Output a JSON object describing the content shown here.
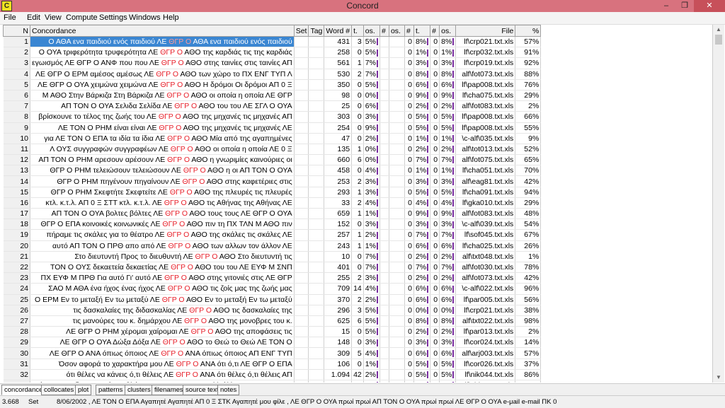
{
  "window": {
    "title": "Concord",
    "icon_letter": "C",
    "minimize": "–",
    "maximize": "❐",
    "close": "✕"
  },
  "menu": [
    "File",
    "Edit",
    "View",
    "Compute",
    "Settings",
    "Windows",
    "Help"
  ],
  "columns": {
    "n": "N",
    "concordance": "Concordance",
    "set": "Set",
    "tag": "Tag",
    "word": "Word #",
    "t1": "t.",
    "os1": "os.",
    "d1": "#",
    "os2": "os.",
    "d2": "#",
    "t2": "t.",
    "d3": "#",
    "os3": "os.",
    "file": "File",
    "pct": "%"
  },
  "rows": [
    {
      "n": "1",
      "left": "Ο ΑΘΑ ενα παιδιού ενός παιδιού ΛΕ",
      "kw": "ΘΓΡ Ο",
      "right": "ΑΘΑ ενα παιδιού ενός παιδιού",
      "word": "431",
      "sent": "3",
      "sp": "5%",
      "para": "0",
      "pp": "8%",
      "head": "0",
      "hp": "8%",
      "file": "lf\\crp021.txt.xls",
      "pct": "57%"
    },
    {
      "n": "2",
      "left": "Ο ΟΥΑ τριφερότητα τρυφερότητα ΛΕ",
      "kw": "ΘΓΡ Ο",
      "right": "ΑΘΟ της καρδιάς τις της καρδιάς",
      "word": "258",
      "sent": "0",
      "sp": "5%",
      "para": "0",
      "pp": "1%",
      "head": "0",
      "hp": "1%",
      "file": "lf\\crp032.txt.xls",
      "pct": "91%"
    },
    {
      "n": "3",
      "left": "εγωισμός ΛΕ ΘΓΡ Ο ΑΝΦ που που ΛΕ",
      "kw": "ΘΓΡ Ο",
      "right": "ΑΘΟ στης ταινίες στις ταινίες ΑΠ",
      "word": "561",
      "sent": "1",
      "sp": "7%",
      "para": "0",
      "pp": "3%",
      "head": "0",
      "hp": "3%",
      "file": "lf\\crp019.txt.xls",
      "pct": "92%"
    },
    {
      "n": "4",
      "left": "ΛΕ ΘΓΡ Ο ΕΡΜ αμέσος αμέσως ΛΕ",
      "kw": "ΘΓΡ Ο",
      "right": "ΑΘΟ των χώρο το ΠΧ ΕΝΓ ΤΥΠ Λ",
      "word": "530",
      "sent": "2",
      "sp": "7%",
      "para": "0",
      "pp": "8%",
      "head": "0",
      "hp": "8%",
      "file": "alf\\fot073.txt.xls",
      "pct": "88%"
    },
    {
      "n": "5",
      "left": "ΛΕ ΘΓΡ Ο ΟΥΑ χειμώνα χειμώνα ΛΕ",
      "kw": "ΘΓΡ Ο",
      "right": "ΑΘΟ Η δρόμοι Οι δρόμοι ΑΠ 0 Ξ",
      "word": "350",
      "sent": "0",
      "sp": "5%",
      "para": "0",
      "pp": "6%",
      "head": "0",
      "hp": "6%",
      "file": "lf\\pap008.txt.xls",
      "pct": "76%"
    },
    {
      "n": "6",
      "left": "Μ ΑΘΟ Στην Βάρκιζα Στη Βάρκιζα ΛΕ",
      "kw": "ΘΓΡ Ο",
      "right": "ΑΘΟ οι οποία η οποία ΛΕ ΘΓΡ",
      "word": "98",
      "sent": "0",
      "sp": "0%",
      "para": "0",
      "pp": "9%",
      "head": "0",
      "hp": "9%",
      "file": "lf\\cha075.txt.xls",
      "pct": "29%"
    },
    {
      "n": "7",
      "left": "ΑΠ ΤΟΝ Ο ΟΥΑ Σελιδα Σελίδα ΛΕ",
      "kw": "ΘΓΡ Ο",
      "right": "ΑΘΟ του του ΛΕ ΣΓΛ Ο ΟΥΑ",
      "word": "25",
      "sent": "0",
      "sp": "6%",
      "para": "0",
      "pp": "2%",
      "head": "0",
      "hp": "2%",
      "file": "alf\\fot083.txt.xls",
      "pct": "2%"
    },
    {
      "n": "8",
      "left": "βρίσκουνε το τέλος της ζωής του ΛΕ",
      "kw": "ΘΓΡ Ο",
      "right": "ΑΘΟ της μηχανές τις μηχανές ΑΠ",
      "word": "303",
      "sent": "0",
      "sp": "3%",
      "para": "0",
      "pp": "5%",
      "head": "0",
      "hp": "5%",
      "file": "lf\\pap008.txt.xls",
      "pct": "66%"
    },
    {
      "n": "9",
      "left": "ΛΕ ΤΟΝ Ο ΡΗΜ είναι είναι ΛΕ",
      "kw": "ΘΓΡ Ο",
      "right": "ΑΘΟ της μηχανές τις μηχανές ΛΕ",
      "word": "254",
      "sent": "0",
      "sp": "9%",
      "para": "0",
      "pp": "5%",
      "head": "0",
      "hp": "5%",
      "file": "lf\\pap008.txt.xls",
      "pct": "55%"
    },
    {
      "n": "10",
      "left": "για ΛΕ ΤΟΝ Ο ΕΠΑ τα ιδία τα ίδια ΛΕ",
      "kw": "ΘΓΡ Ο",
      "right": "ΑΘΟ Μία από της αγαπημένες",
      "word": "47",
      "sent": "0",
      "sp": "2%",
      "para": "0",
      "pp": "1%",
      "head": "0",
      "hp": "1%",
      "file": "\\c-alf\\035.txt.xls",
      "pct": "9%"
    },
    {
      "n": "11",
      "left": "Λ ΟΥΣ συγγραφών συγγραφέων ΛΕ",
      "kw": "ΘΓΡ Ο",
      "right": "ΑΘΟ οι οποία η οποία ΛΕ 0 Ξ",
      "word": "135",
      "sent": "1",
      "sp": "0%",
      "para": "0",
      "pp": "2%",
      "head": "0",
      "hp": "2%",
      "file": "alf\\tot013.txt.xls",
      "pct": "52%"
    },
    {
      "n": "12",
      "left": "ΑΠ ΤΟΝ Ο ΡΗΜ αρεσουν αρέσουν ΛΕ",
      "kw": "ΘΓΡ Ο",
      "right": "ΑΘΟ η γνωριμίες καινούριες οι",
      "word": "660",
      "sent": "6",
      "sp": "0%",
      "para": "0",
      "pp": "7%",
      "head": "0",
      "hp": "7%",
      "file": "alf\\fot075.txt.xls",
      "pct": "65%"
    },
    {
      "n": "13",
      "left": "ΘΓΡ Ο ΡΗΜ τελειώσουν τελειώσουν ΛΕ",
      "kw": "ΘΓΡ Ο",
      "right": "ΑΘΟ η οι ΑΠ ΤΟΝ Ο ΟΥΑ",
      "word": "458",
      "sent": "0",
      "sp": "4%",
      "para": "0",
      "pp": "1%",
      "head": "0",
      "hp": "1%",
      "file": "lf\\cha051.txt.xls",
      "pct": "70%"
    },
    {
      "n": "14",
      "left": "ΘΓΡ Ο ΡΗΜ πηγένουν πηγαίνουν ΛΕ",
      "kw": "ΘΓΡ Ο",
      "right": "ΑΘΟ στης καφετέριες στις",
      "word": "253",
      "sent": "2",
      "sp": "3%",
      "para": "0",
      "pp": "3%",
      "head": "0",
      "hp": "3%",
      "file": "alf\\eag81.txt.xls",
      "pct": "42%"
    },
    {
      "n": "15",
      "left": "ΘΓΡ Ο ΡΗΜ Σκεφτήτε Σκεφτείτε ΛΕ",
      "kw": "ΘΓΡ Ο",
      "right": "ΑΘΟ της πλευρές τις πλευρές",
      "word": "293",
      "sent": "1",
      "sp": "3%",
      "para": "0",
      "pp": "5%",
      "head": "0",
      "hp": "5%",
      "file": "lf\\cha091.txt.xls",
      "pct": "94%"
    },
    {
      "n": "16",
      "left": "κτλ. κ.τ.λ. ΑΠ 0 Ξ ΣΤΤ κτλ. κ.τ.λ. ΛΕ",
      "kw": "ΘΓΡ Ο",
      "right": "ΑΘΟ τις Αθήνας της Αθήνας ΛΕ",
      "word": "33",
      "sent": "2",
      "sp": "4%",
      "para": "0",
      "pp": "4%",
      "head": "0",
      "hp": "4%",
      "file": "lf\\gka010.txt.xls",
      "pct": "29%"
    },
    {
      "n": "17",
      "left": "ΑΠ ΤΟΝ Ο ΟΥΑ βολτες βόλτες ΛΕ",
      "kw": "ΘΓΡ Ο",
      "right": "ΑΘΟ τους τους ΛΕ ΘΓΡ Ο ΟΥΑ",
      "word": "659",
      "sent": "1",
      "sp": "1%",
      "para": "0",
      "pp": "9%",
      "head": "0",
      "hp": "9%",
      "file": "alf\\fot083.txt.xls",
      "pct": "48%"
    },
    {
      "n": "18",
      "left": "ΘΓΡ Ο ΕΠΑ κοινοικές κοινωνικές ΛΕ",
      "kw": "ΘΓΡ Ο",
      "right": "ΑΘΟ πιν τη ΠΧ ΤΛΝ Μ ΑΘΟ πιν",
      "word": "152",
      "sent": "0",
      "sp": "3%",
      "para": "0",
      "pp": "3%",
      "head": "0",
      "hp": "3%",
      "file": "\\c-alf\\039.txt.xls",
      "pct": "54%"
    },
    {
      "n": "19",
      "left": "πήραμε τις σκάλες για το θέατρο ΛΕ",
      "kw": "ΘΓΡ Ο",
      "right": "ΑΘΟ της σκάλες τις σκάλες ΛΕ",
      "word": "257",
      "sent": "1",
      "sp": "2%",
      "para": "0",
      "pp": "7%",
      "head": "0",
      "hp": "7%",
      "file": "lf\\sof045.txt.xls",
      "pct": "67%"
    },
    {
      "n": "20",
      "left": "αυτό ΑΠ ΤΟΝ Ο ΠΡΘ απο από ΛΕ",
      "kw": "ΘΓΡ Ο",
      "right": "ΑΘΟ των αλλων τον άλλον ΛΕ",
      "word": "243",
      "sent": "1",
      "sp": "1%",
      "para": "0",
      "pp": "6%",
      "head": "0",
      "hp": "6%",
      "file": "lf\\cha025.txt.xls",
      "pct": "26%"
    },
    {
      "n": "21",
      "left": "Στο διευτυντή Προς το διευθυντή ΛΕ",
      "kw": "ΘΓΡ Ο",
      "right": "ΑΘΟ Στο διευτυντή τις",
      "word": "10",
      "sent": "0",
      "sp": "7%",
      "para": "0",
      "pp": "2%",
      "head": "0",
      "hp": "2%",
      "file": "alf\\txt048.txt.xls",
      "pct": "1%"
    },
    {
      "n": "22",
      "left": "ΤΟΝ Ο ΟΥΣ δεκαετεία δεκαετίας ΛΕ",
      "kw": "ΘΓΡ Ο",
      "right": "ΑΘΟ του του ΛΕ ΕΥΦ Μ ΣΝΠ",
      "word": "401",
      "sent": "0",
      "sp": "7%",
      "para": "0",
      "pp": "7%",
      "head": "0",
      "hp": "7%",
      "file": "alf\\fot030.txt.xls",
      "pct": "78%"
    },
    {
      "n": "23",
      "left": "ΠΧ ΕΥΦ Μ ΠΡΘ Για αυτό Γι' αυτό ΛΕ",
      "kw": "ΘΓΡ Ο",
      "right": "ΑΘΟ στης γιτονιές στις ΛΕ ΘΓΡ",
      "word": "255",
      "sent": "2",
      "sp": "3%",
      "para": "0",
      "pp": "2%",
      "head": "0",
      "hp": "2%",
      "file": "alf\\fot073.txt.xls",
      "pct": "42%"
    },
    {
      "n": "24",
      "left": "ΣΑΟ Μ ΑΘΑ ένα ήχος ένας ήχος ΛΕ",
      "kw": "ΘΓΡ Ο",
      "right": "ΑΘΟ τις ζοίς μας της ζωής μας",
      "word": "709",
      "sent": "14",
      "sp": "4%",
      "para": "0",
      "pp": "6%",
      "head": "0",
      "hp": "6%",
      "file": "\\c-alf\\022.txt.xls",
      "pct": "96%"
    },
    {
      "n": "25",
      "left": "Ο ΕΡΜ Εν το μεταξή Εν τω μεταξύ ΛΕ",
      "kw": "ΘΓΡ Ο",
      "right": "ΑΘΟ Εν το μεταξή Εν τω μεταξύ",
      "word": "370",
      "sent": "2",
      "sp": "2%",
      "para": "0",
      "pp": "6%",
      "head": "0",
      "hp": "6%",
      "file": "lf\\par005.txt.xls",
      "pct": "56%"
    },
    {
      "n": "26",
      "left": "τις δασκαλαίες της διδασκαλίας ΛΕ",
      "kw": "ΘΓΡ Ο",
      "right": "ΑΘΟ τις δασκαλαίες της",
      "word": "296",
      "sent": "3",
      "sp": "5%",
      "para": "0",
      "pp": "0%",
      "head": "0",
      "hp": "0%",
      "file": "lf\\crp021.txt.xls",
      "pct": "38%"
    },
    {
      "n": "27",
      "left": "τις μανούρες του κ. δημάρχου ΛΕ",
      "kw": "ΘΓΡ Ο",
      "right": "ΑΘΟ της μονοβρες του κ.",
      "word": "625",
      "sent": "6",
      "sp": "5%",
      "para": "0",
      "pp": "8%",
      "head": "0",
      "hp": "8%",
      "file": "alf\\txt022.txt.xls",
      "pct": "98%"
    },
    {
      "n": "28",
      "left": "ΛΕ ΘΓΡ Ο ΡΗΜ χέρομαι χαίρομαι ΛΕ",
      "kw": "ΘΓΡ Ο",
      "right": "ΑΘΟ της αποφάσεις τις",
      "word": "15",
      "sent": "0",
      "sp": "5%",
      "para": "0",
      "pp": "2%",
      "head": "0",
      "hp": "2%",
      "file": "lf\\par013.txt.xls",
      "pct": "2%"
    },
    {
      "n": "29",
      "left": "ΛΕ ΘΓΡ Ο ΟΥΑ Δώξα Δόξα ΛΕ",
      "kw": "ΘΓΡ Ο",
      "right": "ΑΘΟ το Θεώ το Θεώ ΛΕ ΤΟΝ Ο",
      "word": "148",
      "sent": "0",
      "sp": "3%",
      "para": "0",
      "pp": "3%",
      "head": "0",
      "hp": "3%",
      "file": "lf\\cor024.txt.xls",
      "pct": "14%"
    },
    {
      "n": "30",
      "left": "ΛΕ ΘΓΡ Ο ΑΝΑ όπιως όποιος ΛΕ",
      "kw": "ΘΓΡ Ο",
      "right": "ΑΝΑ όπιως όποιος ΑΠ ΕΝΓ ΤΥΠ",
      "word": "309",
      "sent": "5",
      "sp": "4%",
      "para": "0",
      "pp": "6%",
      "head": "0",
      "hp": "6%",
      "file": "alf\\arj003.txt.xls",
      "pct": "57%"
    },
    {
      "n": "31",
      "left": "Όσον αφορά το χαρακτήρα μου ΛΕ",
      "kw": "ΘΓΡ Ο",
      "right": "ΑΝΑ ότι ό,τι ΛΕ ΘΓΡ Ο ΕΠΑ",
      "word": "106",
      "sent": "0",
      "sp": "1%",
      "para": "0",
      "pp": "5%",
      "head": "0",
      "hp": "5%",
      "file": "lf\\cor026.txt.xls",
      "pct": "37%"
    },
    {
      "n": "32",
      "left": "ότι θέλες να κάνεις ό,τι θέλεις ΛΕ",
      "kw": "ΘΓΡ Ο",
      "right": "ΑΝΑ ότι θέλες ό,τι θέλεις ΑΠ",
      "word": "1.094",
      "sent": "42",
      "sp": "2%",
      "para": "0",
      "pp": "5%",
      "head": "0",
      "hp": "5%",
      "file": "lf\\nik044.txt.xls",
      "pct": "86%"
    },
    {
      "n": "33",
      "left": "όμως, μας δημιουργεί προβλήματα ΛΕ",
      "kw": "ΘΓΡ Ο",
      "right": "ΑΝΑ αλλ άλλα ΛΕ ΤΟΝ Ο ΑΝΑ",
      "word": "291",
      "sent": "0",
      "sp": "5%",
      "para": "0",
      "pp": "4%",
      "head": "0",
      "hp": "4%",
      "file": "lf\\chi034.txt.xls",
      "pct": "65%"
    }
  ],
  "tabs": [
    "concordance",
    "collocates",
    "plot",
    "patterns",
    "clusters",
    "filenames",
    "source text",
    "notes"
  ],
  "status": {
    "count": "3.668",
    "mode": "Set",
    "text": "8/06/2002 , ΛΕ ΤΟΝ Ο ΕΠΑ Αγαπητέ Αγαπητέ ΑΠ 0 Ξ ΣΤΚ Αγαπητέ μου φίλε , ΛΕ ΘΓΡ Ο ΟΥΑ πρωί πρωί ΑΠ ΤΟΝ Ο ΟΥΑ πρωί πρωί ΛΕ ΘΓΡ Ο ΟΥΑ e-μail e-mail ΠΚ 0"
  },
  "colors": {
    "titlebar": "#d8727e",
    "selection": "#3a86d2",
    "keyword": "#e8202a",
    "bar": "#7a2ea0"
  }
}
